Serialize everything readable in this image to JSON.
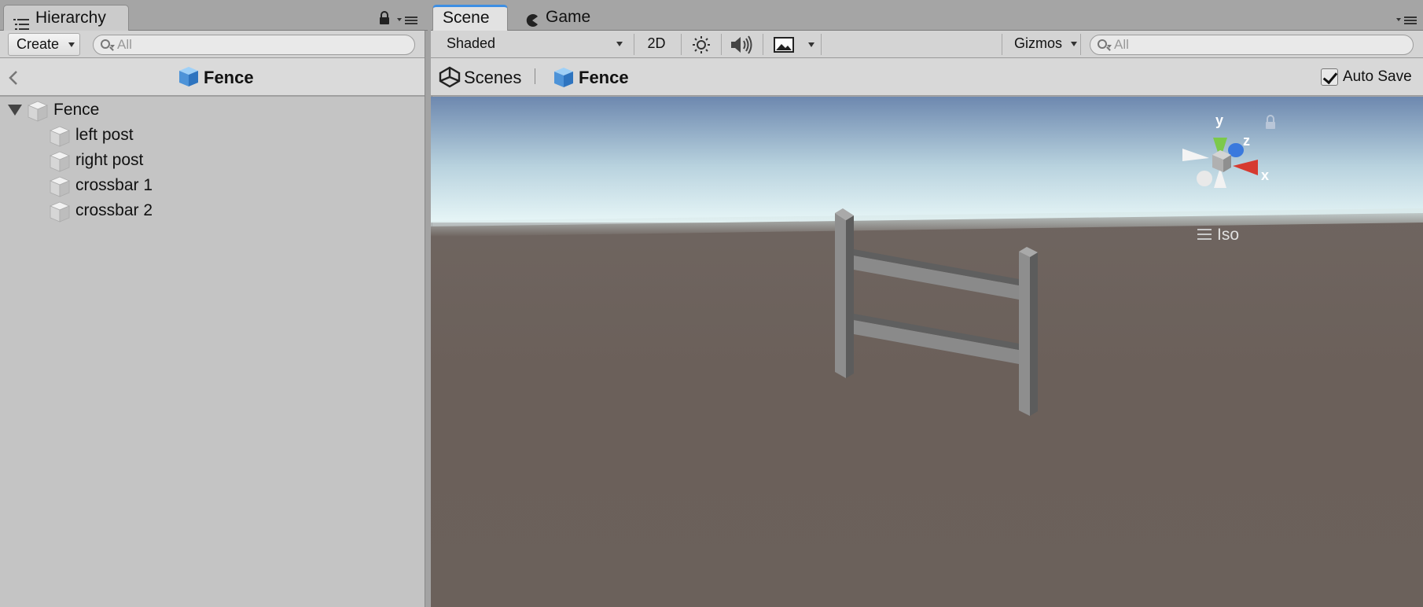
{
  "hierarchy": {
    "tab_label": "Hierarchy",
    "create_label": "Create",
    "search_placeholder": "All",
    "breadcrumb": "Fence",
    "tree": [
      {
        "label": "Fence",
        "expanded": true,
        "depth": 0
      },
      {
        "label": "left post",
        "depth": 1
      },
      {
        "label": "right post",
        "depth": 1
      },
      {
        "label": "crossbar 1",
        "depth": 1
      },
      {
        "label": "crossbar 2",
        "depth": 1
      }
    ]
  },
  "scene": {
    "tabs": [
      {
        "label": "Scene",
        "active": true
      },
      {
        "label": "Game",
        "active": false
      }
    ],
    "shading_mode": "Shaded",
    "toggle_2d": "2D",
    "gizmos_label": "Gizmos",
    "search_placeholder": "All",
    "breadcrumb_root": "Scenes",
    "breadcrumb_current": "Fence",
    "auto_save_label": "Auto Save",
    "auto_save_checked": true,
    "gizmo": {
      "axis_y": "y",
      "axis_z": "z",
      "axis_x": "x",
      "projection": "Iso"
    }
  },
  "colors": {
    "accent": "#3d8ee3",
    "panel_bg": "#c4c4c4",
    "ground": "#6b605a",
    "sky_top": "#6d88af",
    "horizon": "#e7f6f7",
    "axis_x": "#d63a30",
    "axis_y": "#7cc94a",
    "axis_z": "#3a79dd"
  }
}
